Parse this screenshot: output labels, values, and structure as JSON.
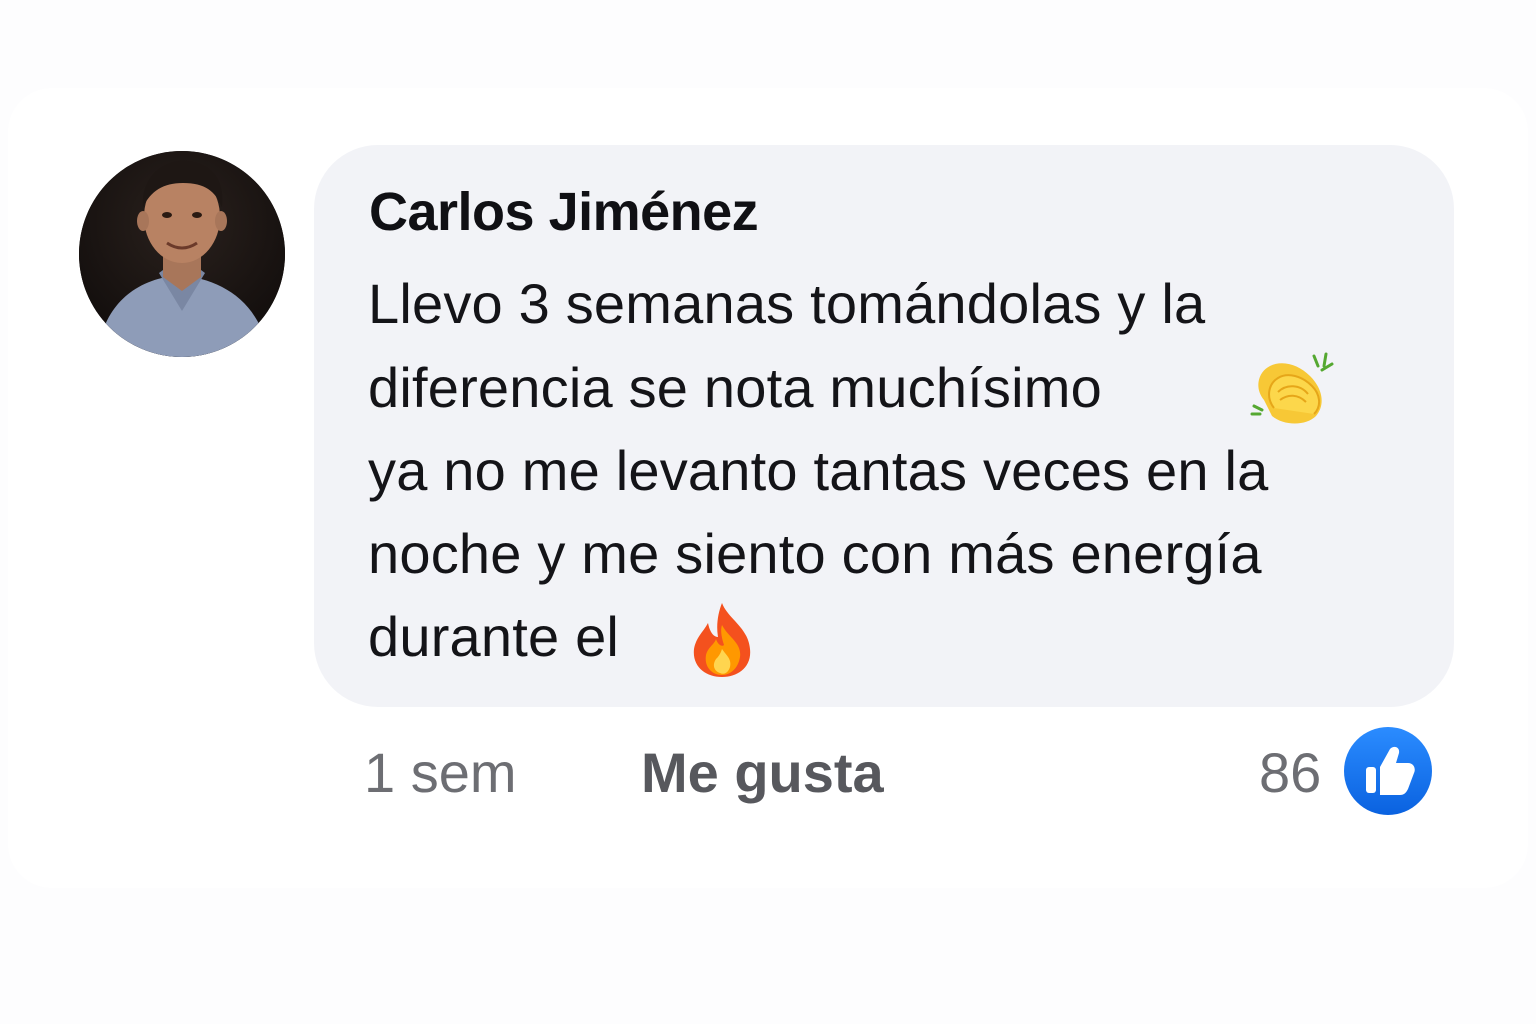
{
  "comment": {
    "author": "Carlos Jiménez",
    "text_lines": [
      "Llevo 3 semanas tomándolas y la",
      "diferencia se nota muchísimo",
      "ya no me levanto tantas veces en la",
      "noche y me siento con más energía",
      "durante el"
    ],
    "emojis": [
      "clapping-hands",
      "fire"
    ],
    "timestamp": "1 sem",
    "like_label": "Me gusta",
    "like_count": "86",
    "reaction_icon": "thumbs-up-icon"
  },
  "colors": {
    "bubble": "#f2f3f7",
    "author": "#101014",
    "meta": "#6d6e73",
    "like_badge": "#1877f2"
  }
}
